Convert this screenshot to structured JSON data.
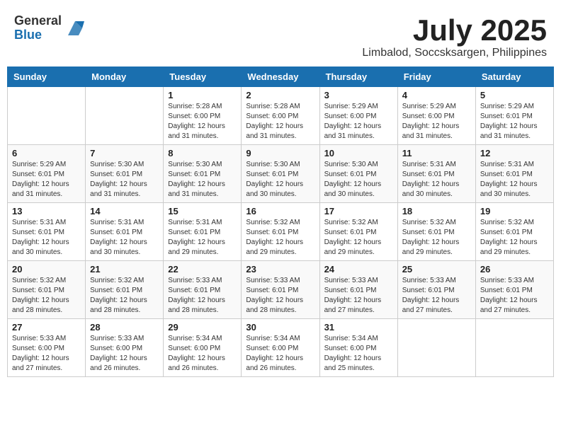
{
  "header": {
    "logo_general": "General",
    "logo_blue": "Blue",
    "month": "July 2025",
    "location": "Limbalod, Soccsksargen, Philippines"
  },
  "days_of_week": [
    "Sunday",
    "Monday",
    "Tuesday",
    "Wednesday",
    "Thursday",
    "Friday",
    "Saturday"
  ],
  "weeks": [
    [
      {
        "day": "",
        "info": ""
      },
      {
        "day": "",
        "info": ""
      },
      {
        "day": "1",
        "info": "Sunrise: 5:28 AM\nSunset: 6:00 PM\nDaylight: 12 hours\nand 31 minutes."
      },
      {
        "day": "2",
        "info": "Sunrise: 5:28 AM\nSunset: 6:00 PM\nDaylight: 12 hours\nand 31 minutes."
      },
      {
        "day": "3",
        "info": "Sunrise: 5:29 AM\nSunset: 6:00 PM\nDaylight: 12 hours\nand 31 minutes."
      },
      {
        "day": "4",
        "info": "Sunrise: 5:29 AM\nSunset: 6:00 PM\nDaylight: 12 hours\nand 31 minutes."
      },
      {
        "day": "5",
        "info": "Sunrise: 5:29 AM\nSunset: 6:01 PM\nDaylight: 12 hours\nand 31 minutes."
      }
    ],
    [
      {
        "day": "6",
        "info": "Sunrise: 5:29 AM\nSunset: 6:01 PM\nDaylight: 12 hours\nand 31 minutes."
      },
      {
        "day": "7",
        "info": "Sunrise: 5:30 AM\nSunset: 6:01 PM\nDaylight: 12 hours\nand 31 minutes."
      },
      {
        "day": "8",
        "info": "Sunrise: 5:30 AM\nSunset: 6:01 PM\nDaylight: 12 hours\nand 31 minutes."
      },
      {
        "day": "9",
        "info": "Sunrise: 5:30 AM\nSunset: 6:01 PM\nDaylight: 12 hours\nand 30 minutes."
      },
      {
        "day": "10",
        "info": "Sunrise: 5:30 AM\nSunset: 6:01 PM\nDaylight: 12 hours\nand 30 minutes."
      },
      {
        "day": "11",
        "info": "Sunrise: 5:31 AM\nSunset: 6:01 PM\nDaylight: 12 hours\nand 30 minutes."
      },
      {
        "day": "12",
        "info": "Sunrise: 5:31 AM\nSunset: 6:01 PM\nDaylight: 12 hours\nand 30 minutes."
      }
    ],
    [
      {
        "day": "13",
        "info": "Sunrise: 5:31 AM\nSunset: 6:01 PM\nDaylight: 12 hours\nand 30 minutes."
      },
      {
        "day": "14",
        "info": "Sunrise: 5:31 AM\nSunset: 6:01 PM\nDaylight: 12 hours\nand 30 minutes."
      },
      {
        "day": "15",
        "info": "Sunrise: 5:31 AM\nSunset: 6:01 PM\nDaylight: 12 hours\nand 29 minutes."
      },
      {
        "day": "16",
        "info": "Sunrise: 5:32 AM\nSunset: 6:01 PM\nDaylight: 12 hours\nand 29 minutes."
      },
      {
        "day": "17",
        "info": "Sunrise: 5:32 AM\nSunset: 6:01 PM\nDaylight: 12 hours\nand 29 minutes."
      },
      {
        "day": "18",
        "info": "Sunrise: 5:32 AM\nSunset: 6:01 PM\nDaylight: 12 hours\nand 29 minutes."
      },
      {
        "day": "19",
        "info": "Sunrise: 5:32 AM\nSunset: 6:01 PM\nDaylight: 12 hours\nand 29 minutes."
      }
    ],
    [
      {
        "day": "20",
        "info": "Sunrise: 5:32 AM\nSunset: 6:01 PM\nDaylight: 12 hours\nand 28 minutes."
      },
      {
        "day": "21",
        "info": "Sunrise: 5:32 AM\nSunset: 6:01 PM\nDaylight: 12 hours\nand 28 minutes."
      },
      {
        "day": "22",
        "info": "Sunrise: 5:33 AM\nSunset: 6:01 PM\nDaylight: 12 hours\nand 28 minutes."
      },
      {
        "day": "23",
        "info": "Sunrise: 5:33 AM\nSunset: 6:01 PM\nDaylight: 12 hours\nand 28 minutes."
      },
      {
        "day": "24",
        "info": "Sunrise: 5:33 AM\nSunset: 6:01 PM\nDaylight: 12 hours\nand 27 minutes."
      },
      {
        "day": "25",
        "info": "Sunrise: 5:33 AM\nSunset: 6:01 PM\nDaylight: 12 hours\nand 27 minutes."
      },
      {
        "day": "26",
        "info": "Sunrise: 5:33 AM\nSunset: 6:01 PM\nDaylight: 12 hours\nand 27 minutes."
      }
    ],
    [
      {
        "day": "27",
        "info": "Sunrise: 5:33 AM\nSunset: 6:00 PM\nDaylight: 12 hours\nand 27 minutes."
      },
      {
        "day": "28",
        "info": "Sunrise: 5:33 AM\nSunset: 6:00 PM\nDaylight: 12 hours\nand 26 minutes."
      },
      {
        "day": "29",
        "info": "Sunrise: 5:34 AM\nSunset: 6:00 PM\nDaylight: 12 hours\nand 26 minutes."
      },
      {
        "day": "30",
        "info": "Sunrise: 5:34 AM\nSunset: 6:00 PM\nDaylight: 12 hours\nand 26 minutes."
      },
      {
        "day": "31",
        "info": "Sunrise: 5:34 AM\nSunset: 6:00 PM\nDaylight: 12 hours\nand 25 minutes."
      },
      {
        "day": "",
        "info": ""
      },
      {
        "day": "",
        "info": ""
      }
    ]
  ]
}
